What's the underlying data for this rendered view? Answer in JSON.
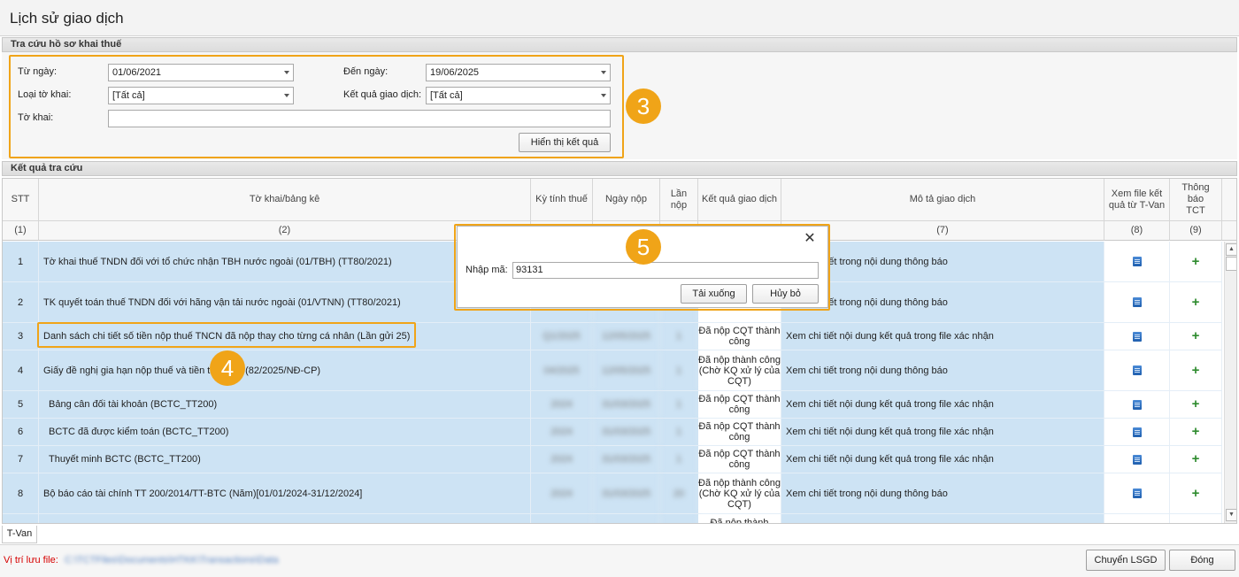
{
  "window": {
    "title": "Lịch sử giao dịch"
  },
  "search": {
    "group_title": "Tra cứu hồ sơ khai thuế",
    "from_date_label": "Từ ngày:",
    "from_date_value": "01/06/2021",
    "to_date_label": "Đến ngày:",
    "to_date_value": "19/06/2025",
    "form_type_label": "Loại tờ khai:",
    "form_type_value": "[Tất cả]",
    "result_label": "Kết quả giao dịch:",
    "result_value": "[Tất cả]",
    "form_label": "Tờ khai:",
    "form_value": "",
    "show_button": "Hiển thị kết quả"
  },
  "annotations": {
    "badge_3": "3",
    "badge_4": "4",
    "badge_5": "5",
    "accent_color": "#f0a418"
  },
  "results": {
    "group_title": "Kết quả tra cứu",
    "columns": [
      "STT",
      "Tờ khai/bảng kê",
      "Kỳ tính thuế",
      "Ngày nộp",
      "Lần nộp",
      "Kết quả giao dịch",
      "Mô tả giao dịch",
      "Xem file kết quả từ T-Van",
      "Thông báo TCT"
    ],
    "column_numbers": [
      "(1)",
      "(2)",
      "",
      "",
      "",
      "",
      "(7)",
      "(8)",
      "(9)"
    ],
    "rows": [
      {
        "stt": "1",
        "name": "Tờ khai thuế TNDN đối với tổ chức nhận TBH nước ngoài (01/TBH) (TT80/2021)",
        "period": "",
        "date": "",
        "times": "",
        "result": "",
        "desc": "Xem chi tiết trong nội dung thông báo"
      },
      {
        "stt": "2",
        "name": "TK quyết toán thuế TNDN đối với hãng vận tải nước ngoài (01/VTNN) (TT80/2021)",
        "period": "",
        "date": "",
        "times": "",
        "result": "lý của CQT)",
        "desc": "Xem chi tiết trong nội dung thông báo"
      },
      {
        "stt": "3",
        "name": "Danh sách chi tiết số tiền nộp thuế TNCN đã nộp thay cho từng cá nhân (Lần gửi 25)",
        "period": "Q1/2025",
        "date": "12/05/2025",
        "times": "1",
        "result": "Đã nộp CQT thành công",
        "desc": "Xem chi tiết nội dung kết quả trong file xác nhận"
      },
      {
        "stt": "4",
        "name": "Giấy đề nghị gia hạn nộp thuế và tiền thuê đất (82/2025/NĐ-CP)",
        "period": "04/2025",
        "date": "12/05/2025",
        "times": "1",
        "result": "Đã nộp thành công (Chờ KQ xử lý của CQT)",
        "desc": "Xem chi tiết trong nội dung thông báo"
      },
      {
        "stt": "5",
        "name": "Bảng cân đối tài khoản (BCTC_TT200)",
        "period": "2024",
        "date": "31/03/2025",
        "times": "1",
        "result": "Đã nộp CQT thành công",
        "desc": "Xem chi tiết nội dung kết quả trong file xác nhận"
      },
      {
        "stt": "6",
        "name": "BCTC đã được kiểm toán (BCTC_TT200)",
        "period": "2024",
        "date": "31/03/2025",
        "times": "1",
        "result": "Đã nộp CQT thành công",
        "desc": "Xem chi tiết nội dung kết quả trong file xác nhận"
      },
      {
        "stt": "7",
        "name": "Thuyết minh BCTC (BCTC_TT200)",
        "period": "2024",
        "date": "31/03/2025",
        "times": "1",
        "result": "Đã nộp CQT thành công",
        "desc": "Xem chi tiết nội dung kết quả trong file xác nhận"
      },
      {
        "stt": "8",
        "name": "Bộ báo cáo tài chính TT 200/2014/TT-BTC (Năm)[01/01/2024-31/12/2024]",
        "period": "2024",
        "date": "31/03/2025",
        "times": "20",
        "result": "Đã nộp thành công (Chờ KQ xử lý của CQT)",
        "desc": "Xem chi tiết trong nội dung thông báo"
      },
      {
        "stt": "",
        "name": "",
        "period": "",
        "date": "",
        "times": "",
        "result": "Đã nộp thành",
        "desc": ""
      }
    ]
  },
  "tabs": {
    "tvan": "T-Van"
  },
  "footer": {
    "path_label": "Vị trí lưu file:",
    "path_value": "C:\\TCTFiles\\Documents\\HTKK\\Transactions\\Data",
    "history_button": "Chuyển LSGD",
    "close_button": "Đóng"
  },
  "dialog": {
    "code_label": "Nhập mã:",
    "code_value": "93131",
    "download_button": "Tải xuống",
    "cancel_button": "Hủy bỏ"
  }
}
